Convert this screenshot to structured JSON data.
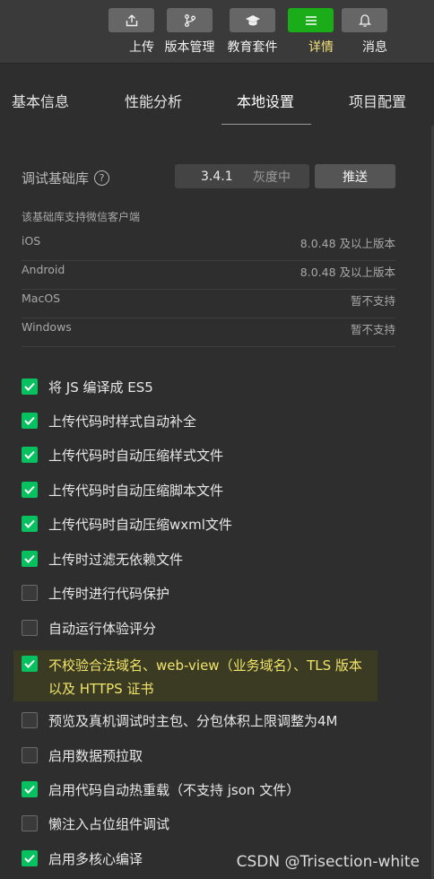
{
  "toolbar": {
    "items": [
      {
        "label": "上传",
        "icon": "upload-icon",
        "active": false
      },
      {
        "label": "版本管理",
        "icon": "branch-icon",
        "active": false
      },
      {
        "label": "教育套件",
        "icon": "graduation-cap-icon",
        "active": false
      },
      {
        "label": "详情",
        "icon": "menu-icon",
        "active": true
      },
      {
        "label": "消息",
        "icon": "bell-icon",
        "active": false
      }
    ]
  },
  "tabs": [
    {
      "label": "基本信息"
    },
    {
      "label": "性能分析"
    },
    {
      "label": "本地设置",
      "active": true
    },
    {
      "label": "项目配置"
    }
  ],
  "base_lib": {
    "label": "调试基础库",
    "help": "?",
    "version": "3.4.1",
    "version_status": "灰度中",
    "push_label": "推送",
    "support_caption": "该基础库支持微信客户端",
    "platforms": [
      {
        "os": "iOS",
        "requirement": "8.0.48 及以上版本"
      },
      {
        "os": "Android",
        "requirement": "8.0.48 及以上版本"
      },
      {
        "os": "MacOS",
        "requirement": "暂不支持"
      },
      {
        "os": "Windows",
        "requirement": "暂不支持"
      }
    ]
  },
  "options": [
    {
      "label": "将 JS 编译成 ES5",
      "checked": true
    },
    {
      "label": "上传代码时样式自动补全",
      "checked": true
    },
    {
      "label": "上传代码时自动压缩样式文件",
      "checked": true
    },
    {
      "label": "上传代码时自动压缩脚本文件",
      "checked": true
    },
    {
      "label": "上传代码时自动压缩wxml文件",
      "checked": true
    },
    {
      "label": "上传时过滤无依赖文件",
      "checked": true
    },
    {
      "label": "上传时进行代码保护",
      "checked": false
    },
    {
      "label": "自动运行体验评分",
      "checked": false
    },
    {
      "label": "不校验合法域名、web-view（业务域名）、TLS 版本以及 HTTPS 证书",
      "checked": true,
      "highlighted": true
    },
    {
      "label": "预览及真机调试时主包、分包体积上限调整为4M",
      "checked": false
    },
    {
      "label": "启用数据预拉取",
      "checked": false
    },
    {
      "label": "启用代码自动热重载（不支持 json 文件）",
      "checked": true
    },
    {
      "label": "懒注入占位组件调试",
      "checked": false
    },
    {
      "label": "启用多核心编译",
      "checked": true
    }
  ],
  "colors": {
    "accent": "#07c160",
    "active_tool": "#1aad19",
    "highlight_text": "#f0e46a",
    "background": "#2e2e2e"
  },
  "watermark": "CSDN @Trisection-white"
}
